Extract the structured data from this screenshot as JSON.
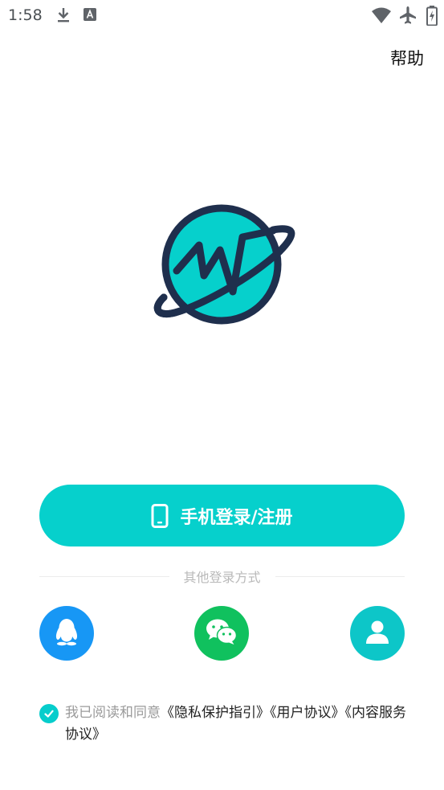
{
  "status_bar": {
    "time": "1:58",
    "icons": [
      "download-icon",
      "a-notification-icon",
      "wifi-icon",
      "airplane-icon",
      "battery-icon"
    ]
  },
  "header": {
    "help_label": "帮助"
  },
  "logo": {
    "icon": "planet-wave-logo",
    "colors": {
      "fill": "#06d0cc",
      "stroke": "#1f2f4d"
    }
  },
  "main": {
    "login_button": {
      "icon": "phone-icon",
      "label": "手机登录/注册",
      "color": "#06d0cc"
    },
    "other_login_label": "其他登录方式",
    "social_logins": [
      {
        "id": "qq",
        "icon": "qq-icon",
        "color": "#1797f5"
      },
      {
        "id": "wechat",
        "icon": "wechat-icon",
        "color": "#10c15e"
      },
      {
        "id": "guest",
        "icon": "user-icon",
        "color": "#0dc6c8"
      }
    ]
  },
  "agreement": {
    "checked": true,
    "prefix": "我已阅读和同意",
    "links": [
      "《隐私保护指引》",
      "《用户协议》",
      "《内容服务协议》"
    ]
  }
}
